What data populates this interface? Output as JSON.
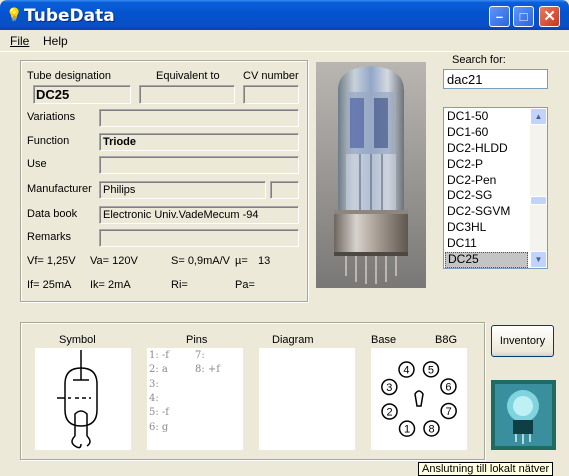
{
  "window": {
    "title": "TubeData",
    "controls": {
      "minimize": "–",
      "maximize": "□",
      "close": "✕"
    },
    "icon": "lightbulb-icon"
  },
  "menu": [
    "File",
    "Help"
  ],
  "fields": {
    "tube_designation": {
      "label": "Tube designation",
      "value": "DC25"
    },
    "equivalent_to": {
      "label": "Equivalent to",
      "value": ""
    },
    "cv_number": {
      "label": "CV number",
      "value": ""
    },
    "variations": {
      "label": "Variations",
      "value": ""
    },
    "function": {
      "label": "Function",
      "value": "Triode"
    },
    "use": {
      "label": "Use",
      "value": ""
    },
    "manufacturer": {
      "label": "Manufacturer",
      "value": "Philips",
      "extra": ""
    },
    "data_book": {
      "label": "Data book",
      "value": "Electronic Univ.VadeMecum -94"
    },
    "remarks": {
      "label": "Remarks",
      "value": ""
    }
  },
  "electrical": {
    "vf": "Vf= 1,25V",
    "va": "Va= 120V",
    "s": "S= 0,9mA/V",
    "mu_label": "µ=",
    "mu_value": "13",
    "if": "If= 25mA",
    "ik": "Ik=  2mA",
    "ri": "Ri=",
    "pa": "Pa="
  },
  "search": {
    "label": "Search for:",
    "value": "dac21"
  },
  "tube_list": {
    "items": [
      "DC1-50",
      "DC1-60",
      "DC2-HLDD",
      "DC2-P",
      "DC2-Pen",
      "DC2-SG",
      "DC2-SGVM",
      "DC3HL",
      "DC11",
      "DC25"
    ],
    "selected": "DC25",
    "scroll_up": "▲",
    "scroll_down": "▼"
  },
  "panels": {
    "symbol_title": "Symbol",
    "pins_title": "Pins",
    "diagram_title": "Diagram",
    "base_title": "Base",
    "base_type": "B8G"
  },
  "pins": {
    "left": [
      "1: -f",
      "2: a",
      "3:",
      "4:",
      "5: -f",
      "6: g"
    ],
    "right": [
      "7:",
      "8: +f"
    ]
  },
  "base_pins": [
    "1",
    "2",
    "3",
    "4",
    "5",
    "6",
    "7",
    "8"
  ],
  "buttons": {
    "inventory": "Inventory"
  },
  "tooltip": "Anslutning till lokalt nätver",
  "colors": {
    "titlebar": "#0454d0",
    "window_bg": "#ece9d8",
    "close_button": "#c9361a"
  }
}
